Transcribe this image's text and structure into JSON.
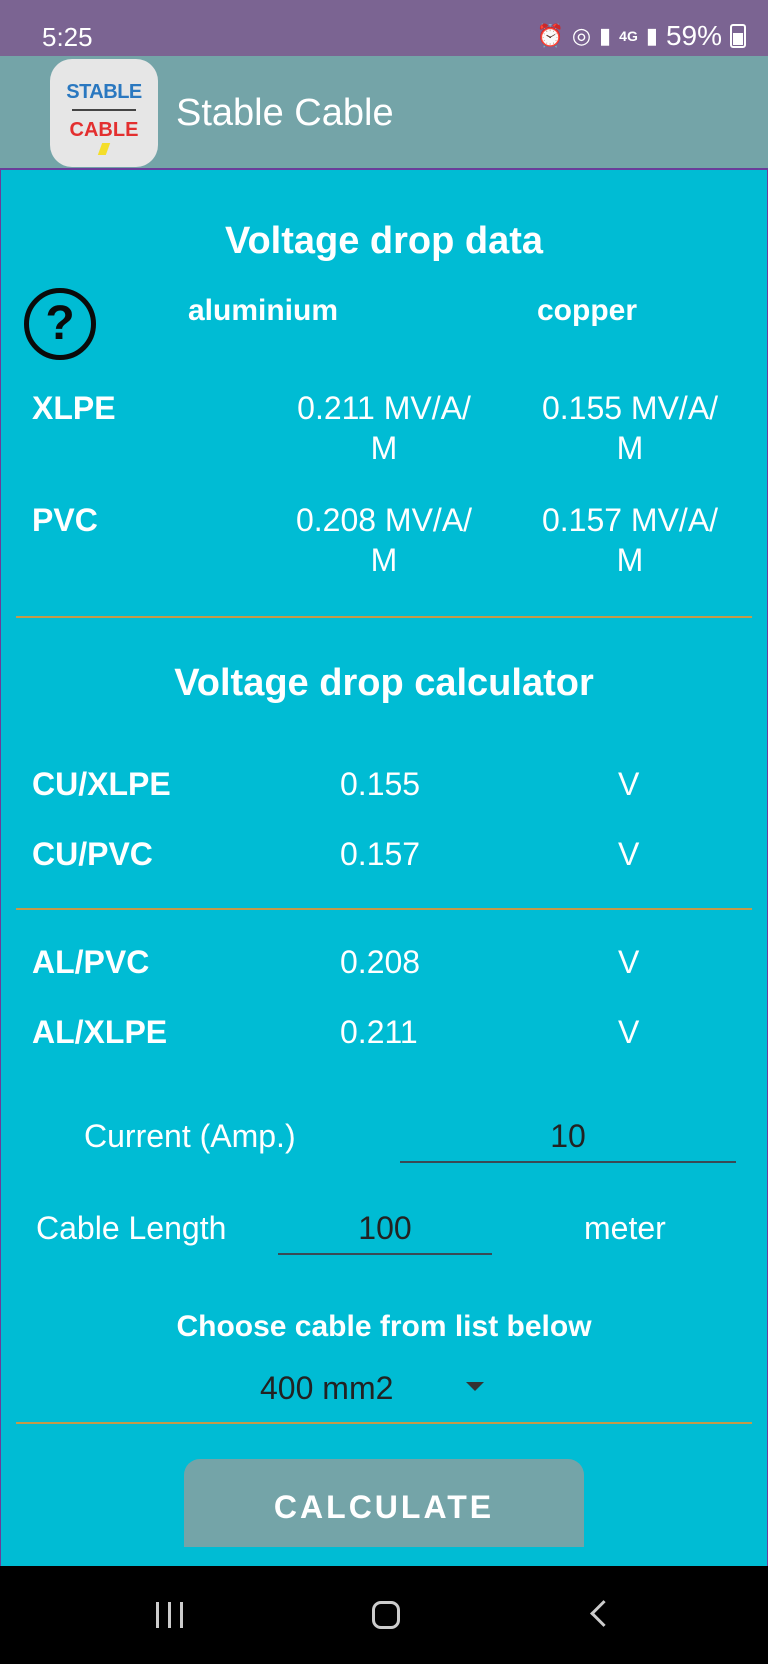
{
  "status_bar": {
    "time": "5:25",
    "network": "4G",
    "battery": "59%"
  },
  "app_bar": {
    "title": "Stable Cable",
    "icon_line1": "STABLE",
    "icon_line2": "CABLE"
  },
  "voltage_drop_data": {
    "heading": "Voltage drop data",
    "col_aluminium": "aluminium",
    "col_copper": "copper",
    "rows": [
      {
        "label": "XLPE",
        "aluminium_value": "0.211 MV/A/",
        "aluminium_unit_wrap": "M",
        "copper_value": "0.155 MV/A/",
        "copper_unit_wrap": "M"
      },
      {
        "label": "PVC",
        "aluminium_value": "0.208 MV/A/",
        "aluminium_unit_wrap": "M",
        "copper_value": "0.157 MV/A/",
        "copper_unit_wrap": "M"
      }
    ]
  },
  "calculator": {
    "heading": "Voltage drop calculator",
    "results_copper": [
      {
        "label": "CU/XLPE",
        "value": "0.155",
        "unit": "V"
      },
      {
        "label": "CU/PVC",
        "value": "0.157",
        "unit": "V"
      }
    ],
    "results_aluminium": [
      {
        "label": "AL/PVC",
        "value": "0.208",
        "unit": "V"
      },
      {
        "label": "AL/XLPE",
        "value": "0.211",
        "unit": "V"
      }
    ],
    "current_label": "Current (Amp.)",
    "current_value": "10",
    "length_label": "Cable Length",
    "length_value": "100",
    "length_unit": "meter",
    "choose_label": "Choose cable from list below",
    "cable_selected": "400 mm2",
    "calculate_label": "CALCULATE"
  }
}
